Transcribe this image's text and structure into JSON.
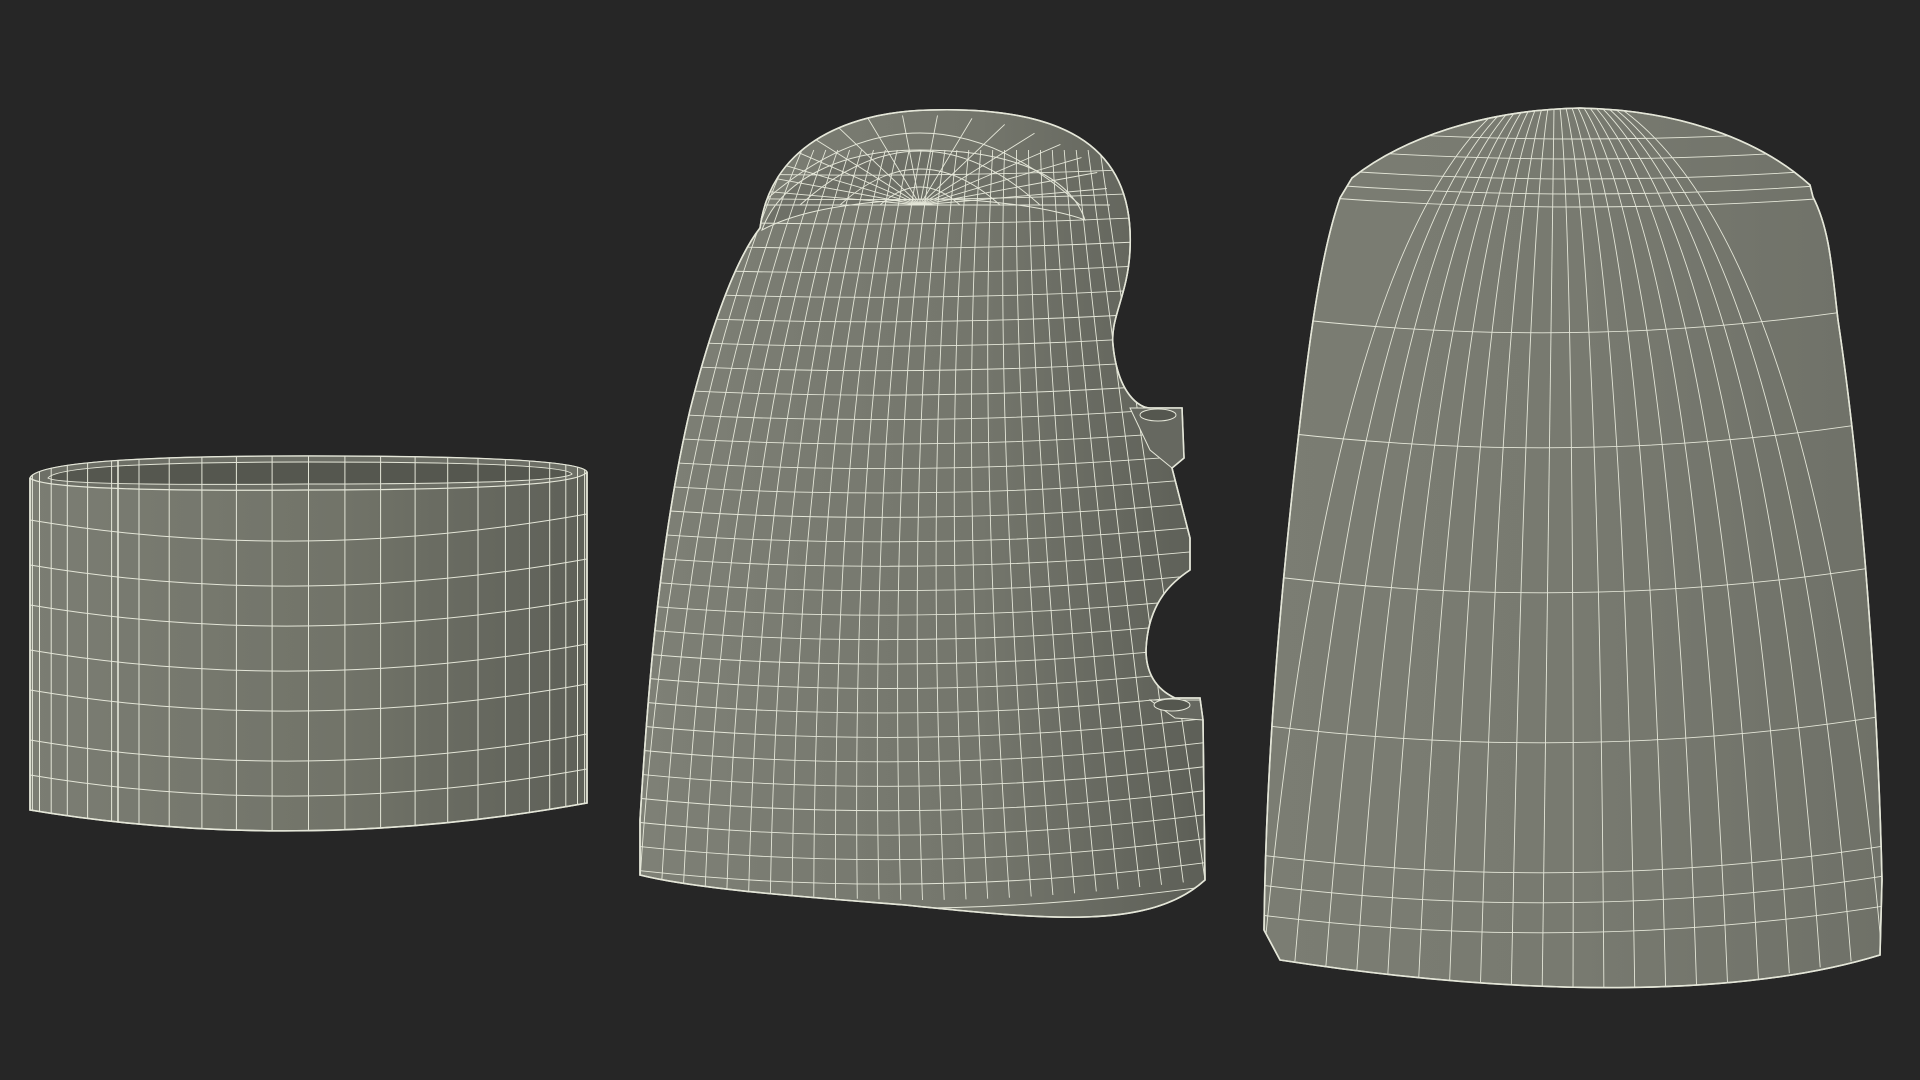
{
  "scene": {
    "background": "#262626",
    "surface_color": "#787a70",
    "surface_shadow": "#5f615a",
    "surface_highlight": "#868880",
    "wire_color": "#e4e6d8",
    "objects": [
      {
        "name": "ring-band",
        "kind": "cylinder-band"
      },
      {
        "name": "curved-cap-with-side-notch",
        "kind": "curved-cap"
      },
      {
        "name": "dome-cap",
        "kind": "dome"
      }
    ]
  }
}
